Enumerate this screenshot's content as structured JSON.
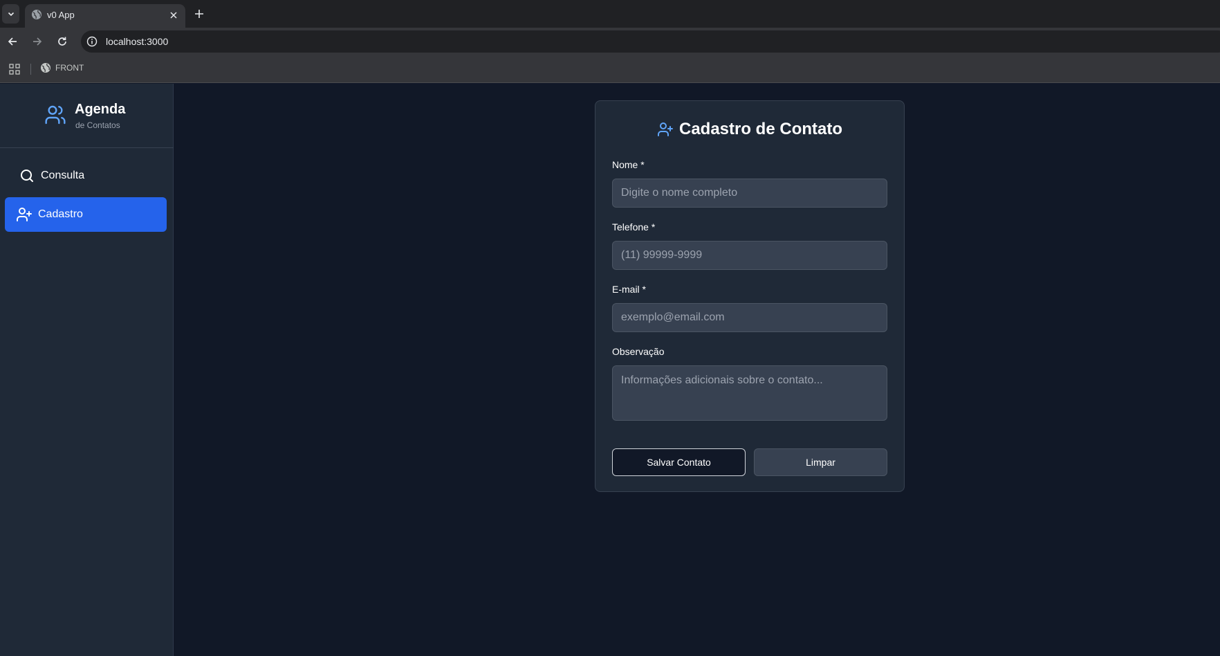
{
  "browser": {
    "tab_title": "v0 App",
    "url": "localhost:3000",
    "bookmark_label": "FRONT"
  },
  "sidebar": {
    "brand_title": "Agenda",
    "brand_subtitle": "de Contatos",
    "items": [
      {
        "label": "Consulta",
        "icon": "search-icon",
        "active": false
      },
      {
        "label": "Cadastro",
        "icon": "user-plus-icon",
        "active": true
      }
    ]
  },
  "form": {
    "title": "Cadastro de Contato",
    "fields": [
      {
        "label": "Nome *",
        "placeholder": "Digite o nome completo",
        "value": ""
      },
      {
        "label": "Telefone *",
        "placeholder": "(11) 99999-9999",
        "value": ""
      },
      {
        "label": "E-mail *",
        "placeholder": "exemplo@email.com",
        "value": ""
      },
      {
        "label": "Observação",
        "placeholder": "Informações adicionais sobre o contato...",
        "value": ""
      }
    ],
    "save_label": "Salvar Contato",
    "clear_label": "Limpar"
  },
  "colors": {
    "accent": "#2563eb",
    "sidebar_bg": "#1f2937",
    "content_bg": "#111827",
    "input_bg": "#374151",
    "icon_blue": "#60a5fa"
  }
}
